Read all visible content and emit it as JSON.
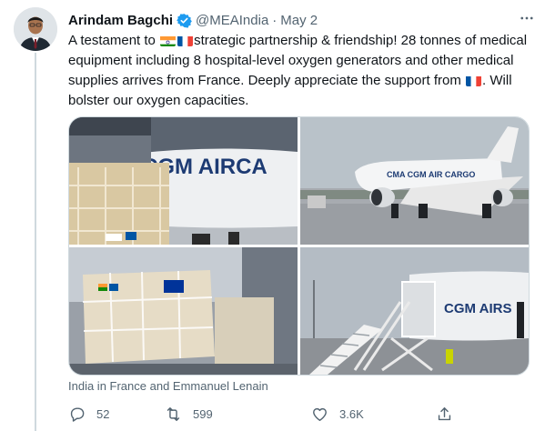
{
  "tweet": {
    "author_name": "Arindam Bagchi",
    "handle": "@MEAIndia",
    "separator": "·",
    "date": "May 2",
    "text_part1": "A testament to ",
    "text_part2": "strategic partnership & friendship! 28 tonnes of medical equipment including 8 hospital-level oxygen generators and other medical supplies arrives from France. Deeply appreciate the support from ",
    "text_part3": ". Will bolster our oxygen capacities.",
    "flags": [
      "india-flag",
      "france-flag"
    ],
    "more_icon": "more-icon",
    "verified_icon": "verified-badge-icon"
  },
  "media": {
    "images": [
      {
        "label": "cgm-aircargo-plane-fuselage-photo",
        "fuselage_text": "CGM AIRCA"
      },
      {
        "label": "cgm-aircargo-plane-taxiing-photo",
        "fuselage_text": "CMA CGM AIR CARGO"
      },
      {
        "label": "palletized-medical-equipment-photo"
      },
      {
        "label": "cargo-loader-at-plane-photo",
        "fuselage_text": "CGM AIRS"
      }
    ],
    "caption": "India in France and Emmanuel Lenain"
  },
  "actions": {
    "reply_count": "52",
    "retweet_count": "599",
    "like_count": "3.6K",
    "icons": [
      "reply-icon",
      "retweet-icon",
      "like-icon",
      "share-icon"
    ]
  },
  "colors": {
    "text": "#0f1419",
    "secondary": "#536471",
    "verified": "#1d9bf0",
    "border": "#cfd9de"
  }
}
